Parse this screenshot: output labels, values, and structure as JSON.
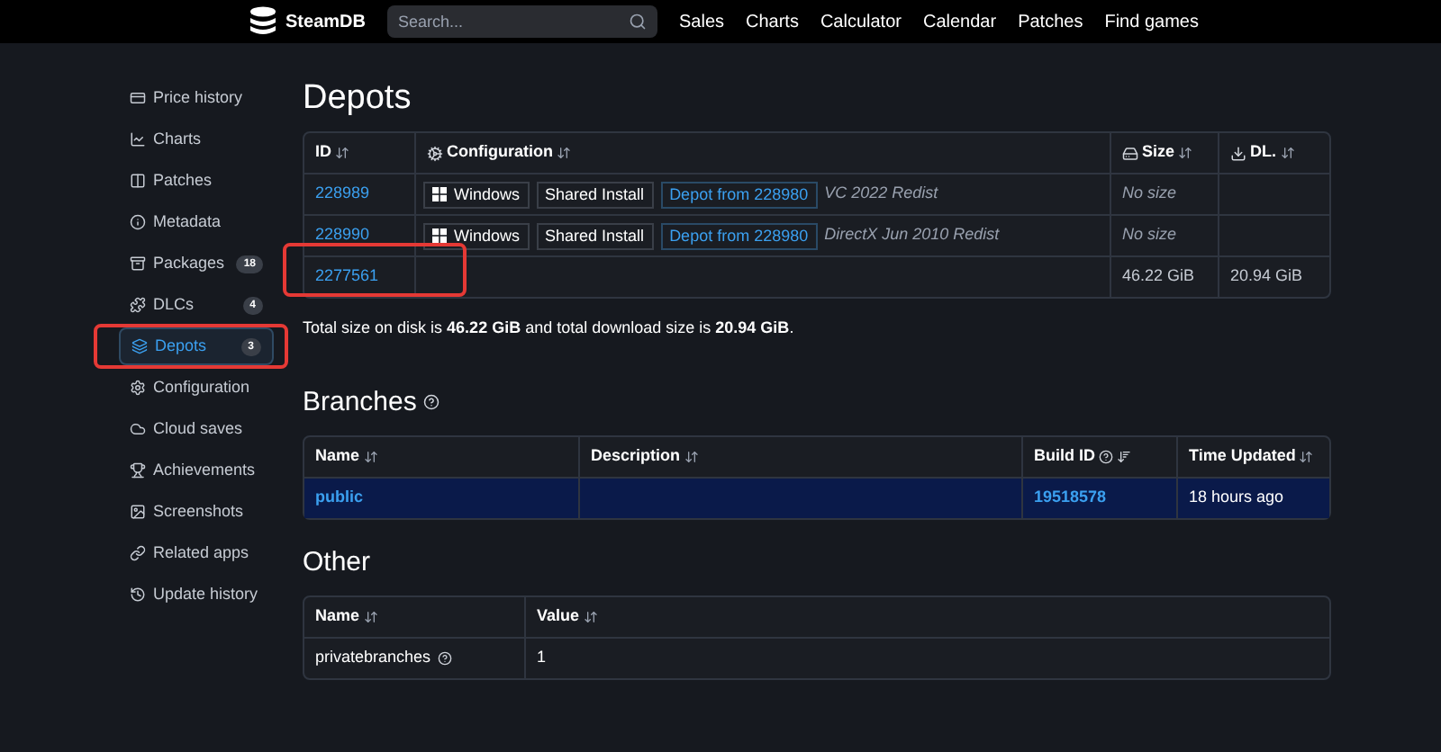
{
  "nav": {
    "logo": "SteamDB",
    "search": {
      "placeholder": "Search..."
    },
    "links": [
      "Sales",
      "Charts",
      "Calculator",
      "Calendar",
      "Patches",
      "Find games"
    ]
  },
  "sidebar": {
    "items": [
      {
        "label": "Price history",
        "selected": false,
        "highlighted": false
      },
      {
        "label": "Charts",
        "selected": false,
        "highlighted": false
      },
      {
        "label": "Patches",
        "selected": false,
        "highlighted": false
      },
      {
        "label": "Metadata",
        "selected": false,
        "highlighted": false
      },
      {
        "label": "Packages",
        "count": "18",
        "selected": false,
        "highlighted": false
      },
      {
        "label": "DLCs",
        "count": "4",
        "selected": false,
        "highlighted": false
      },
      {
        "label": "Depots",
        "count": "3",
        "selected": true,
        "highlighted": true
      },
      {
        "label": "Configuration",
        "selected": false,
        "highlighted": false
      },
      {
        "label": "Cloud saves",
        "selected": false,
        "highlighted": false
      },
      {
        "label": "Achievements",
        "selected": false,
        "highlighted": false
      },
      {
        "label": "Screenshots",
        "selected": false,
        "highlighted": false
      },
      {
        "label": "Related apps",
        "selected": false,
        "highlighted": false
      },
      {
        "label": "Update history",
        "selected": false,
        "highlighted": false
      }
    ]
  },
  "depots": {
    "title": "Depots",
    "columns": [
      "ID",
      "Configuration",
      "Size",
      "DL."
    ],
    "rows": [
      {
        "id": "228989",
        "os": "Windows",
        "tags": [
          "Shared Install"
        ],
        "link": "Depot from 228980",
        "note": "VC 2022 Redist",
        "size": "No size",
        "size_known": false,
        "highlighted": false
      },
      {
        "id": "228990",
        "os": "Windows",
        "tags": [
          "Shared Install"
        ],
        "link": "Depot from 228980",
        "note": "DirectX Jun 2010 Redist",
        "size": "No size",
        "size_known": false,
        "highlighted": false
      },
      {
        "id": "2277561",
        "size": "46.22 GiB",
        "size_known": true,
        "dl": "20.94 GiB",
        "highlighted": true
      }
    ],
    "summary": "Total size on disk is **46.22 GiB** and total download size is **20.94 GiB**."
  },
  "branches": {
    "title": "Branches",
    "columns": [
      "Name",
      "Description",
      "Build ID",
      "Time Updated"
    ],
    "rows": [
      {
        "name": "public",
        "build_id": "19518578",
        "time": "18 hours ago",
        "selected": true
      }
    ]
  },
  "other": {
    "title": "Other",
    "columns": [
      "Name",
      "Value"
    ],
    "rows": [
      {
        "name": "privatebranches",
        "value": "1"
      }
    ]
  }
}
